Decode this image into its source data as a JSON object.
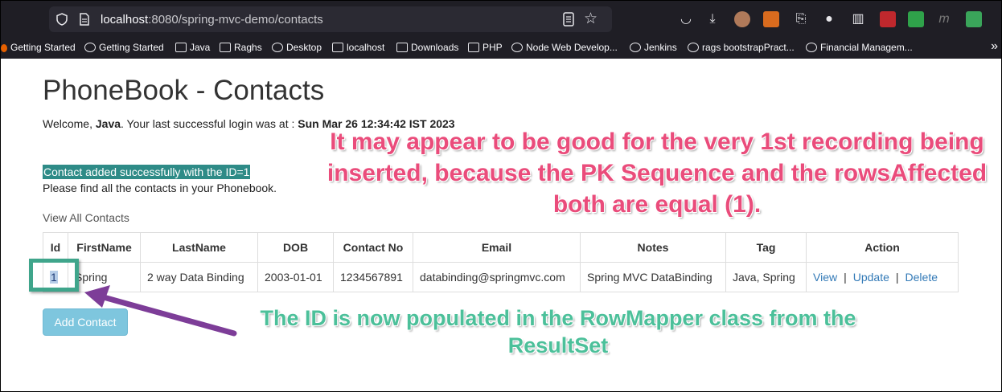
{
  "browser": {
    "url_host": "localhost",
    "url_rest": ":8080/spring-mvc-demo/contacts",
    "bookmarks": [
      {
        "label": "Getting Started",
        "icon": "firefox-icon"
      },
      {
        "label": "Getting Started",
        "icon": "globe-icon"
      },
      {
        "label": "Java",
        "icon": "folder-icon"
      },
      {
        "label": "Raghs",
        "icon": "folder-icon"
      },
      {
        "label": "Desktop",
        "icon": "globe-icon"
      },
      {
        "label": "localhost",
        "icon": "folder-icon"
      },
      {
        "label": "Downloads",
        "icon": "folder-icon"
      },
      {
        "label": "PHP",
        "icon": "folder-icon"
      },
      {
        "label": "Node Web Develop...",
        "icon": "globe-icon"
      },
      {
        "label": "Jenkins",
        "icon": "globe-icon"
      },
      {
        "label": "rags bootstrapPract...",
        "icon": "globe-icon"
      },
      {
        "label": "Financial Managem...",
        "icon": "globe-icon"
      }
    ],
    "more_bookmarks": "»"
  },
  "page": {
    "title": "PhoneBook - Contacts",
    "welcome_prefix": "Welcome, ",
    "welcome_user": "Java",
    "welcome_mid": ". Your last successful login was at : ",
    "welcome_time": "Sun Mar 26 12:34:42 IST 2023",
    "success_message": "Contact added successfully with the ID=1",
    "info_message": "Please find all the contacts in your Phonebook.",
    "view_all": "View All Contacts",
    "add_button": "Add Contact"
  },
  "table": {
    "headers": [
      "Id",
      "FirstName",
      "LastName",
      "DOB",
      "Contact No",
      "Email",
      "Notes",
      "Tag",
      "Action"
    ],
    "rows": [
      {
        "id": "1",
        "first_name": "Spring",
        "last_name": "2 way Data Binding",
        "dob": "2003-01-01",
        "contact_no": "1234567891",
        "email": "databinding@springmvc.com",
        "notes": "Spring MVC DataBinding",
        "tag": "Java, Spring",
        "actions": {
          "view": "View",
          "update": "Update",
          "delete": "Delete",
          "separator": "|"
        }
      }
    ]
  },
  "annotations": {
    "pink_text": "It may appear to be good for the very 1st recording being inserted, because the PK Sequence and the rowsAffected both are equal (1).",
    "green_text": "The ID is now populated in the RowMapper class from the ResultSet",
    "colors": {
      "pink": "#ea4c7b",
      "green": "#4cc09a",
      "box": "#3fa58b",
      "arrow": "#7d3d98"
    }
  }
}
